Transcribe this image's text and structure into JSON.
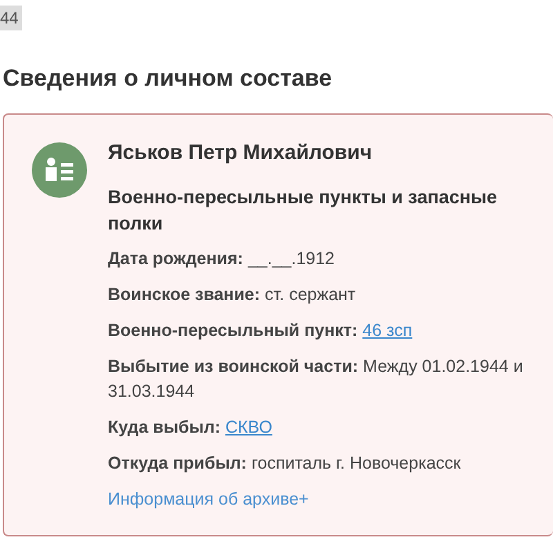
{
  "top_fragment": "44",
  "heading": "Сведения о личном составе",
  "person": {
    "name": "Яськов Петр Михайлович",
    "category": "Военно-пересыльные пункты и запасные полки",
    "fields": [
      {
        "label": "Дата рождения:",
        "value": "__.__.1912",
        "kind": "text"
      },
      {
        "label": "Воинское звание:",
        "value": "ст. сержант",
        "kind": "text"
      },
      {
        "label": "Военно-пересыльный пункт:",
        "value": "46 зсп",
        "kind": "link"
      },
      {
        "label": "Выбытие из воинской части:",
        "value": "Между 01.02.1944 и 31.03.1944",
        "kind": "text"
      },
      {
        "label": "Куда выбыл:",
        "value": "СКВО",
        "kind": "link"
      },
      {
        "label": "Откуда прибыл:",
        "value": "госпиталь г. Новочеркасск",
        "kind": "text"
      }
    ],
    "archive_link": "Информация об архиве+"
  }
}
